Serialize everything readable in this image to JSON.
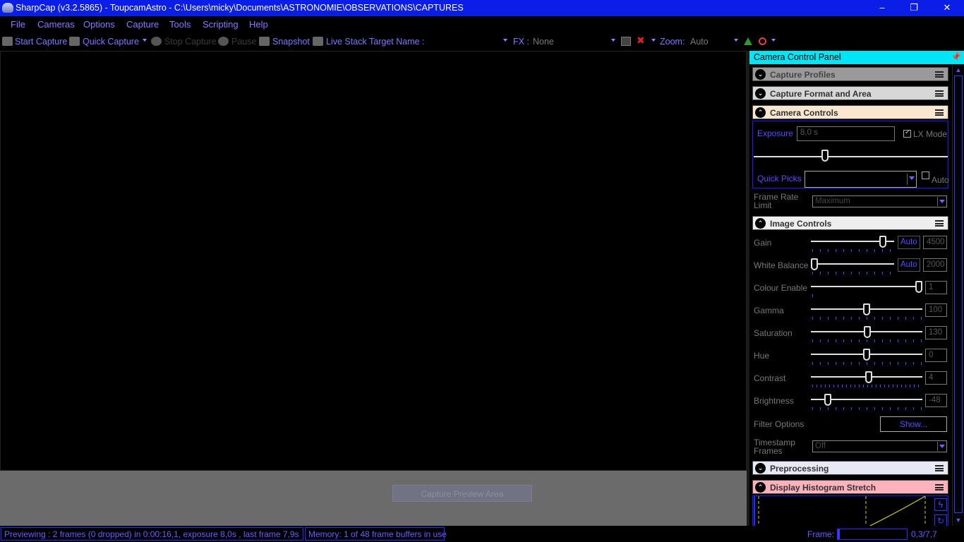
{
  "window": {
    "title": "SharpCap (v3.2.5865) - ToupcamAstro - C:\\Users\\micky\\Documents\\ASTRONOMIE\\OBSERVATIONS\\CAPTURES",
    "minimize": "–",
    "maximize": "❐",
    "close": "✕"
  },
  "menu": [
    "File",
    "Cameras",
    "Options",
    "Capture",
    "Tools",
    "Scripting",
    "Help"
  ],
  "toolbar": {
    "start_capture": "Start Capture",
    "quick_capture": "Quick Capture",
    "stop_capture": "Stop Capture",
    "pause": "Pause",
    "snapshot": "Snapshot",
    "live_stack": "Live Stack",
    "target_name_label": "Target Name :",
    "target_name_value": "",
    "fx_label": "FX :",
    "fx_value": "None",
    "zoom_label": "Zoom:",
    "zoom_value": "Auto"
  },
  "preview": {
    "ghost_button": "Capture Preview Area"
  },
  "panel": {
    "title": "Camera Control Panel",
    "pin_icon": "pin-icon",
    "sections": {
      "capture_profiles": "Capture Profiles",
      "capture_format": "Capture Format and Area",
      "camera_controls": "Camera Controls",
      "image_controls": "Image Controls",
      "preprocessing": "Preprocessing",
      "display_histogram": "Display Histogram Stretch"
    },
    "section_colors": {
      "capture_profiles": "#9a9a9a",
      "capture_format": "#d7d7d7",
      "camera_controls": "#fbe7cf",
      "image_controls": "#eeeeee",
      "preprocessing": "#e8e9f6",
      "display_histogram": "#ffb2bb"
    },
    "camera_controls": {
      "exposure_label": "Exposure",
      "exposure_value": "8,0 s",
      "lx_mode_label": "LX Mode",
      "lx_mode_checked": true,
      "quick_picks_label": "Quick Picks",
      "quick_picks_value": "",
      "auto_label": "Auto",
      "auto_checked": false,
      "frame_rate_label": "Frame Rate Limit",
      "frame_rate_value": "Maximum"
    },
    "image_controls": {
      "gain": {
        "label": "Gain",
        "auto": "Auto",
        "value": "4500"
      },
      "white_balance": {
        "label": "White Balance",
        "auto": "Auto",
        "value": "2000"
      },
      "colour_enable": {
        "label": "Colour Enable",
        "value": "1"
      },
      "gamma": {
        "label": "Gamma",
        "value": "100"
      },
      "saturation": {
        "label": "Saturation",
        "value": "130"
      },
      "hue": {
        "label": "Hue",
        "value": "0"
      },
      "contrast": {
        "label": "Contrast",
        "value": "4"
      },
      "brightness": {
        "label": "Brightness",
        "value": "-48"
      },
      "filter_options_label": "Filter Options",
      "show_button": "Show...",
      "timestamp_label": "Timestamp Frames",
      "timestamp_value": "Off"
    }
  },
  "status": {
    "previewing": "Previewing : 2 frames (0 dropped) in 0:00:16,1, exposure 8,0s , last frame 7,9s",
    "memory": "Memory: 1 of 48 frame buffers in use",
    "frame_label": "Frame:",
    "frame_value": "0,3/7,7"
  },
  "colors": {
    "title_bar": "#0a1ee8",
    "accent_blue": "#5a4cff",
    "panel_header": "#00e5f5"
  }
}
